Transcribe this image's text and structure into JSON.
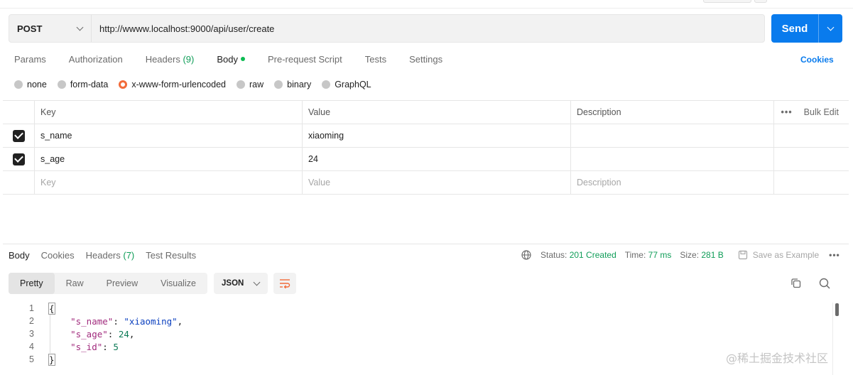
{
  "request": {
    "method": "POST",
    "url": "http://wwww.localhost:9000/api/user/create",
    "send_label": "Send"
  },
  "request_tabs": [
    {
      "label": "Params"
    },
    {
      "label": "Authorization"
    },
    {
      "label": "Headers",
      "count": "(9)"
    },
    {
      "label": "Body",
      "active": true
    },
    {
      "label": "Pre-request Script"
    },
    {
      "label": "Tests"
    },
    {
      "label": "Settings"
    }
  ],
  "cookies_label": "Cookies",
  "body_types": [
    "none",
    "form-data",
    "x-www-form-urlencoded",
    "raw",
    "binary",
    "GraphQL"
  ],
  "body_type_selected": "x-www-form-urlencoded",
  "table": {
    "headers": {
      "key": "Key",
      "value": "Value",
      "description": "Description",
      "bulk_edit": "Bulk Edit",
      "more": "•••"
    },
    "rows": [
      {
        "key": "s_name",
        "value": "xiaoming",
        "checked": true
      },
      {
        "key": "s_age",
        "value": "24",
        "checked": true
      }
    ],
    "placeholders": {
      "key": "Key",
      "value": "Value",
      "description": "Description"
    }
  },
  "response_tabs": [
    {
      "label": "Body",
      "active": true
    },
    {
      "label": "Cookies"
    },
    {
      "label": "Headers",
      "count": "(7)"
    },
    {
      "label": "Test Results"
    }
  ],
  "response_meta": {
    "status_label": "Status:",
    "status_value": "201 Created",
    "time_label": "Time:",
    "time_value": "77 ms",
    "size_label": "Size:",
    "size_value": "281 B",
    "save_example": "Save as Example",
    "more": "•••"
  },
  "view_tabs": [
    "Pretty",
    "Raw",
    "Preview",
    "Visualize"
  ],
  "view_selected": "Pretty",
  "format": "JSON",
  "code_lines": [
    {
      "n": "1"
    },
    {
      "n": "2",
      "key": "\"s_name\"",
      "val": "\"xiaoming\"",
      "kind": "str",
      "comma": true
    },
    {
      "n": "3",
      "key": "\"s_age\"",
      "val": "24",
      "kind": "num",
      "comma": true
    },
    {
      "n": "4",
      "key": "\"s_id\"",
      "val": "5",
      "kind": "num",
      "comma": false
    },
    {
      "n": "5"
    }
  ],
  "watermark": "@稀土掘金技术社区",
  "colors": {
    "accent": "#097bed",
    "success": "#0f9d58",
    "radio_selected": "#f26b3a"
  }
}
